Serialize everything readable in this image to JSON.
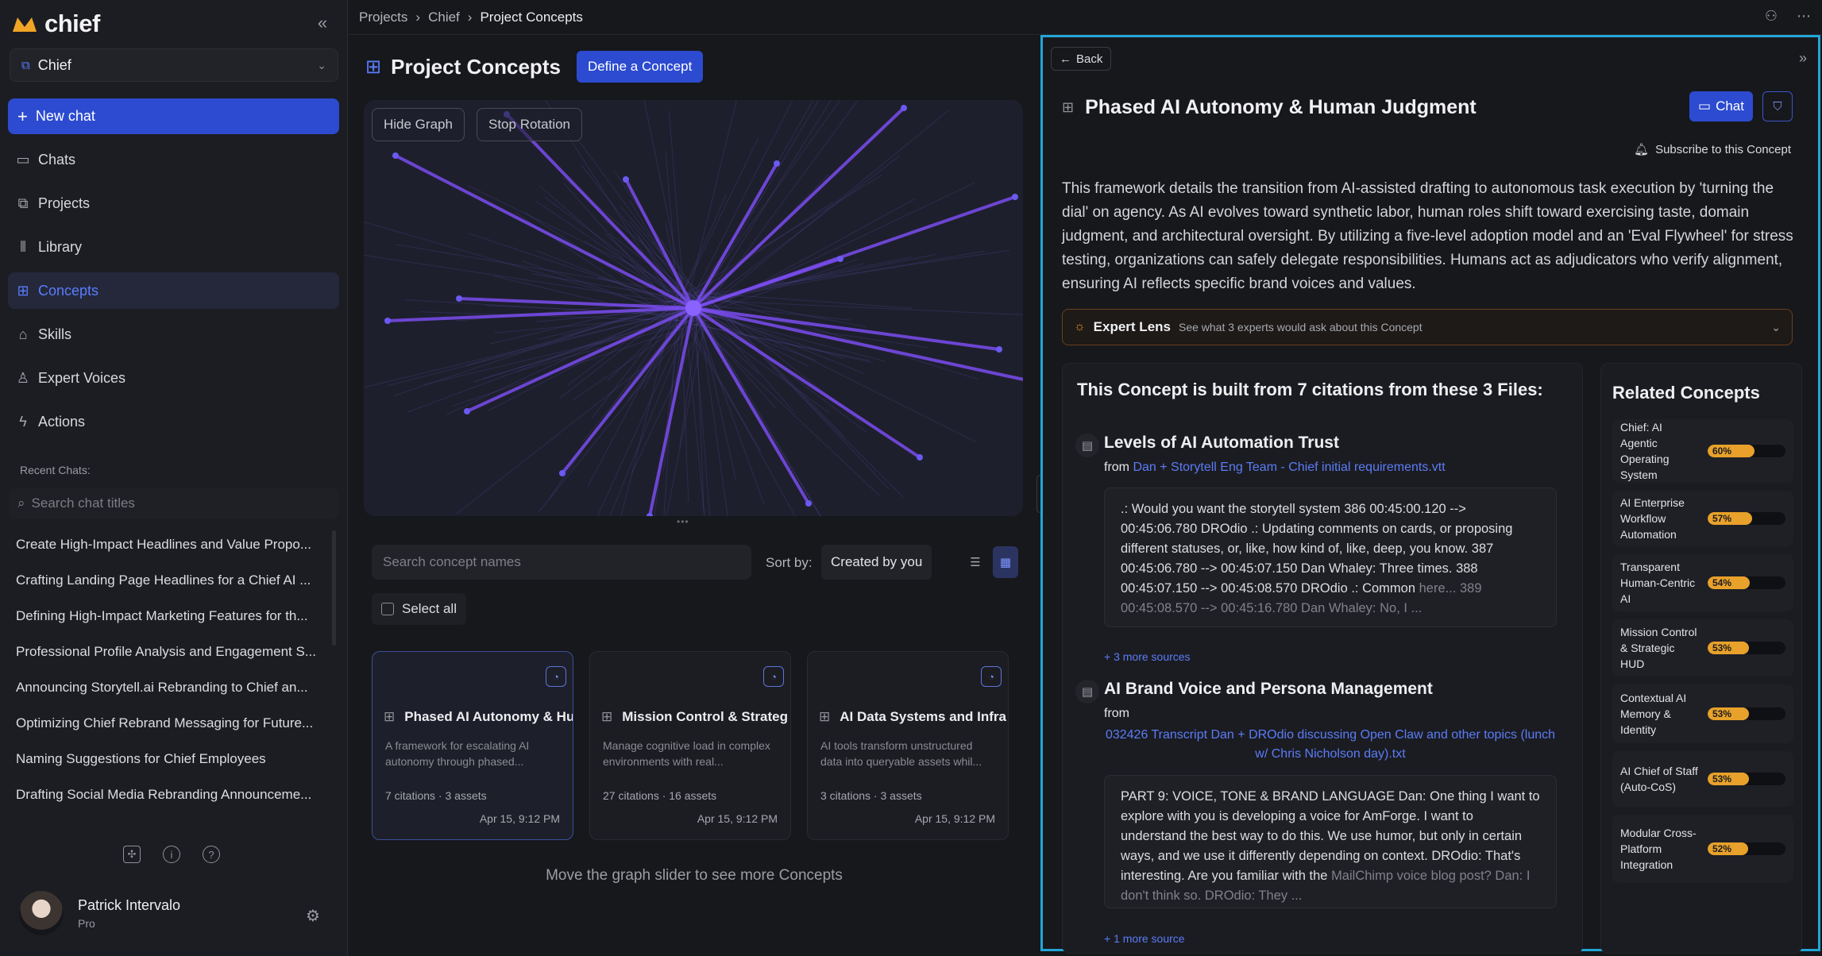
{
  "app": {
    "logo_text": "chief"
  },
  "sidebar": {
    "workspace": "Chief",
    "new_chat": "New chat",
    "nav": [
      {
        "label": "Chats",
        "icon": "chat-icon"
      },
      {
        "label": "Projects",
        "icon": "projects-icon"
      },
      {
        "label": "Library",
        "icon": "library-icon"
      },
      {
        "label": "Concepts",
        "icon": "concepts-icon",
        "active": true
      },
      {
        "label": "Skills",
        "icon": "skills-icon"
      },
      {
        "label": "Expert Voices",
        "icon": "expert-icon"
      },
      {
        "label": "Actions",
        "icon": "bolt-icon"
      }
    ],
    "recent_heading": "Recent Chats:",
    "search_placeholder": "Search chat titles",
    "recent": [
      "Create High-Impact Headlines and Value Propo...",
      "Crafting Landing Page Headlines for a Chief AI ...",
      "Defining High-Impact Marketing Features for th...",
      "Professional Profile Analysis and Engagement S...",
      "Announcing Storytell.ai Rebranding to Chief an...",
      "Optimizing Chief Rebrand Messaging for Future...",
      "Naming Suggestions for Chief Employees",
      "Drafting Social Media Rebranding Announceme..."
    ],
    "user": {
      "name": "Patrick Intervalo",
      "plan": "Pro"
    }
  },
  "breadcrumb": [
    "Projects",
    "Chief",
    "Project Concepts"
  ],
  "main": {
    "title": "Project Concepts",
    "define_button": "Define a Concept",
    "hide_graph": "Hide Graph",
    "stop_rotation": "Stop Rotation",
    "search_placeholder": "Search concept names",
    "sort_label": "Sort by:",
    "sort_value": "Created by you",
    "select_all": "Select all",
    "cards": [
      {
        "title": "Phased AI Autonomy & Hu",
        "desc": "A framework for escalating AI autonomy through phased...",
        "meta": "7 citations · 3 assets",
        "date": "Apr 15, 9:12 PM"
      },
      {
        "title": "Mission Control & Strateg",
        "desc": "Manage cognitive load in complex environments with real...",
        "meta": "27 citations · 16 assets",
        "date": "Apr 15, 9:12 PM"
      },
      {
        "title": "AI Data Systems and Infra",
        "desc": "AI tools transform unstructured data into queryable assets whil...",
        "meta": "3 citations · 3 assets",
        "date": "Apr 15, 9:12 PM"
      }
    ],
    "graph_hint": "Move the graph slider to see more Concepts"
  },
  "panel": {
    "back": "Back",
    "title": "Phased AI Autonomy & Human Judgment",
    "chat_button": "Chat",
    "subscribe": "Subscribe to this Concept",
    "description": "This framework details the transition from AI-assisted drafting to autonomous task execution by 'turning the dial' on agency. As AI evolves toward synthetic labor, human roles shift toward exercising taste, domain judgment, and architectural oversight. By utilizing a five-level adoption model and an 'Eval Flywheel' for stress testing, organizations can safely delegate responsibilities. Humans act as adjudicators who verify alignment, ensuring AI reflects specific brand voices and values.",
    "lens_title": "Expert Lens",
    "lens_sub": "See what 3 experts would ask about this Concept",
    "citations_heading": "This Concept is built from 7 citations from these 3 Files:",
    "files": [
      {
        "title": "Levels of AI Automation Trust",
        "from_label": "from",
        "source": "Dan + Storytell Eng Team - Chief initial requirements.vtt",
        "quote": ".: Would you want the storytell system 386 00:45:00.120 --> 00:45:06.780 DROdio .: Updating comments on cards, or proposing different statuses, or, like, how kind of, like, deep, you know. 387 00:45:06.780 --> 00:45:07.150 Dan Whaley: Three times. 388 00:45:07.150 --> 00:45:08.570 DROdio .: Common",
        "quote_fade": "here... 389 00:45:08.570 --> 00:45:16.780 Dan Whaley: No, I ...",
        "more": "+ 3 more sources"
      },
      {
        "title": "AI Brand Voice and Persona Management",
        "from_label": "from",
        "source": "032426 Transcript Dan + DROdio discussing Open Claw and other topics (lunch w/ Chris Nicholson day).txt",
        "quote": "PART 9: VOICE, TONE & BRAND LANGUAGE Dan: One thing I want to explore with you is developing a voice for AmForge. I want to understand the best way to do this. We use humor, but only in certain ways, and we use it differently depending on context. DROdio: That's interesting. Are you familiar with the",
        "quote_fade": "MailChimp voice blog post? Dan: I don't think so. DROdio: They ...",
        "more": "+ 1 more source"
      }
    ],
    "related_heading": "Related Concepts",
    "related": [
      {
        "name": "Chief: AI Agentic Operating System",
        "pct": 60,
        "label": "60%"
      },
      {
        "name": "AI Enterprise Workflow Automation",
        "pct": 57,
        "label": "57%"
      },
      {
        "name": "Transparent Human-Centric AI",
        "pct": 54,
        "label": "54%"
      },
      {
        "name": "Mission Control & Strategic HUD",
        "pct": 53,
        "label": "53%"
      },
      {
        "name": "Contextual AI Memory & Identity",
        "pct": 53,
        "label": "53%"
      },
      {
        "name": "AI Chief of Staff (Auto-CoS)",
        "pct": 53,
        "label": "53%"
      },
      {
        "name": "Modular Cross-Platform Integration",
        "pct": 52,
        "label": "52%"
      }
    ]
  },
  "colors": {
    "accent": "#2c4bd0",
    "highlight": "#22a6d6",
    "graph_line": "#7a4cf0",
    "score": "#e8a12a"
  }
}
